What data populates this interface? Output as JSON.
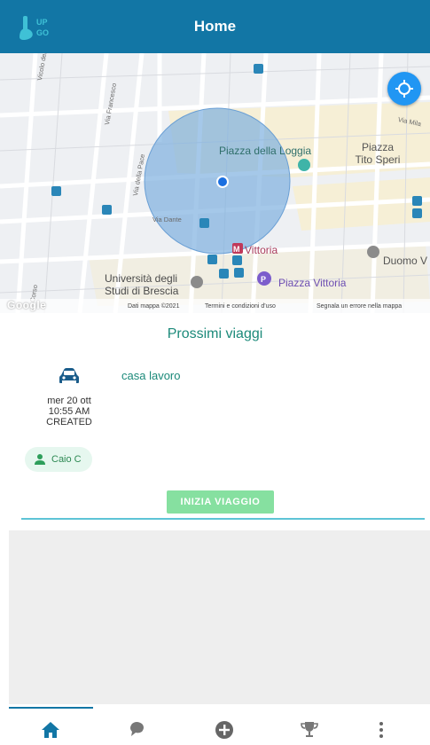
{
  "app": {
    "title": "Home",
    "logo_text": "UP GO",
    "brand_color": "#1276a5"
  },
  "map": {
    "places": {
      "piazza_loggia": "Piazza della Loggia",
      "piazza_tito_speri_1": "Piazza",
      "piazza_tito_speri_2": "Tito Speri",
      "vittoria": "Vittoria",
      "duomo": "Duomo V",
      "universita_1": "Università degli",
      "universita_2": "Studi di Brescia",
      "piazza_vittoria": "Piazza Vittoria"
    },
    "streets": {
      "vicolo": "Vicolo del L",
      "via_francesco": "Via Francesco",
      "via_della_pace": "Via della Pace",
      "via_dante": "Via Dante",
      "via_mila": "Via Mila",
      "corso": "Corso"
    },
    "footer": {
      "google": "Google",
      "dati": "Dati mappa ©2021",
      "termini": "Termini e condizioni d'uso",
      "segnala": "Segnala un errore nella mappa"
    },
    "locate_icon": "gps-crosshair-icon"
  },
  "trips": {
    "section_title": "Prossimi viaggi",
    "items": [
      {
        "destination": "casa lavoro",
        "date_line1": "mer 20 ott",
        "date_line2": "10:55 AM",
        "status": "CREATED",
        "passenger": "Caio C",
        "icon": "car-icon"
      }
    ],
    "start_label": "INIZIA VIAGGIO"
  },
  "bottom_nav": {
    "items": [
      "home-icon",
      "chat-icon",
      "add-circle-icon",
      "trophy-icon",
      "more-vert-icon"
    ],
    "active": 0
  }
}
